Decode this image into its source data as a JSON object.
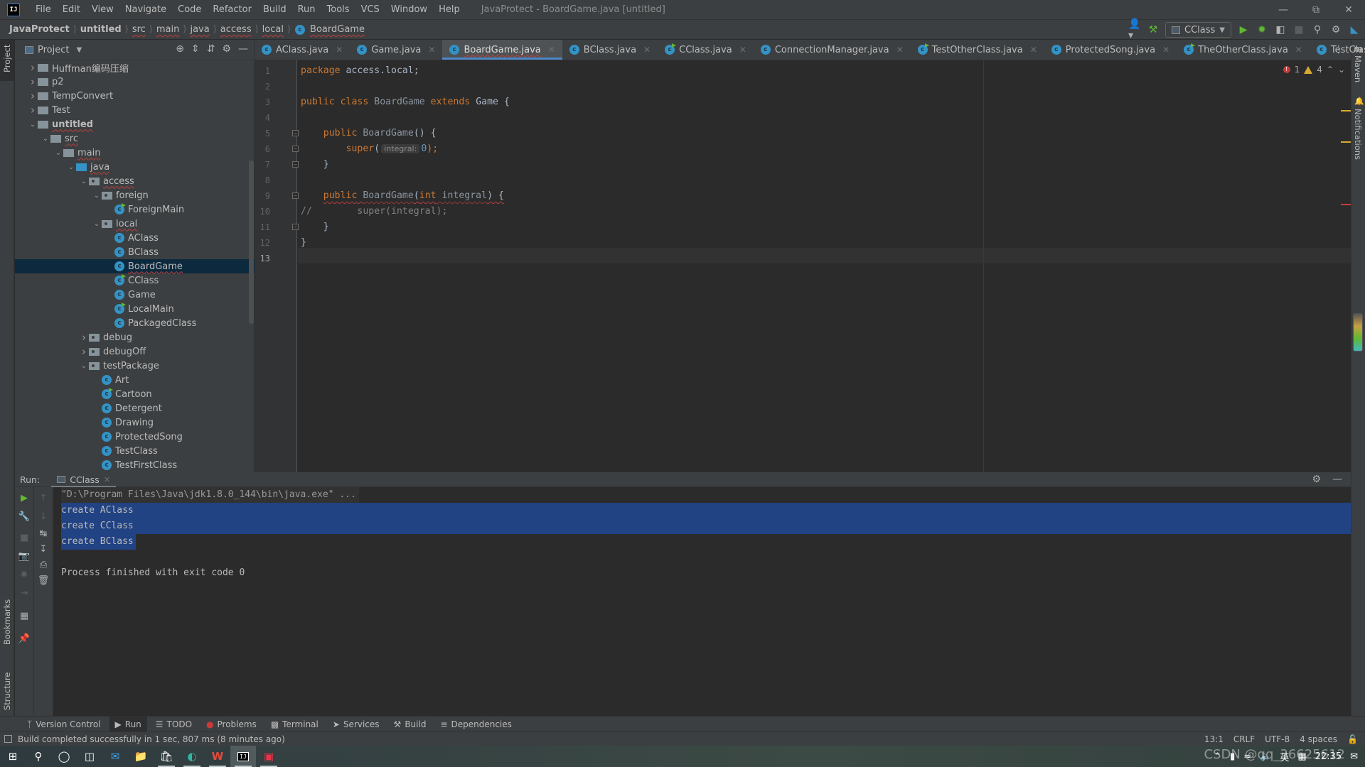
{
  "titlebar": {
    "logo": "IJ",
    "menu": [
      "File",
      "Edit",
      "View",
      "Navigate",
      "Code",
      "Refactor",
      "Build",
      "Run",
      "Tools",
      "VCS",
      "Window",
      "Help"
    ],
    "window_title": "JavaProtect - BoardGame.java [untitled]"
  },
  "breadcrumb": [
    "JavaProtect",
    "untitled",
    "src",
    "main",
    "java",
    "access",
    "local",
    "BoardGame"
  ],
  "toolbar": {
    "run_config": "CClass"
  },
  "left_stripe": {
    "project": "Project",
    "bookmarks": "Bookmarks",
    "structure": "Structure"
  },
  "right_stripe": {
    "maven": "Maven",
    "notifications": "Notifications"
  },
  "project_panel": {
    "title": "Project",
    "tree": [
      {
        "label": "Huffman编码压缩",
        "depth": 0,
        "type": "folder",
        "arrow": "right"
      },
      {
        "label": "p2",
        "depth": 0,
        "type": "folder",
        "arrow": "right"
      },
      {
        "label": "TempConvert",
        "depth": 0,
        "type": "folder",
        "arrow": "right"
      },
      {
        "label": "Test",
        "depth": 0,
        "type": "folder",
        "arrow": "right"
      },
      {
        "label": "untitled",
        "depth": 0,
        "type": "module",
        "arrow": "down"
      },
      {
        "label": "src",
        "depth": 1,
        "type": "folder",
        "arrow": "down"
      },
      {
        "label": "main",
        "depth": 2,
        "type": "folder",
        "arrow": "down"
      },
      {
        "label": "java",
        "depth": 3,
        "type": "src",
        "arrow": "down"
      },
      {
        "label": "access",
        "depth": 4,
        "type": "pkg",
        "arrow": "down"
      },
      {
        "label": "foreign",
        "depth": 5,
        "type": "pkg",
        "arrow": "down"
      },
      {
        "label": "ForeignMain",
        "depth": 6,
        "type": "class-run"
      },
      {
        "label": "local",
        "depth": 5,
        "type": "pkg",
        "arrow": "down"
      },
      {
        "label": "AClass",
        "depth": 6,
        "type": "class"
      },
      {
        "label": "BClass",
        "depth": 6,
        "type": "class"
      },
      {
        "label": "BoardGame",
        "depth": 6,
        "type": "class",
        "selected": true
      },
      {
        "label": "CClass",
        "depth": 6,
        "type": "class-run"
      },
      {
        "label": "Game",
        "depth": 6,
        "type": "class"
      },
      {
        "label": "LocalMain",
        "depth": 6,
        "type": "class-run"
      },
      {
        "label": "PackagedClass",
        "depth": 6,
        "type": "class"
      },
      {
        "label": "debug",
        "depth": 4,
        "type": "pkg",
        "arrow": "right"
      },
      {
        "label": "debugOff",
        "depth": 4,
        "type": "pkg",
        "arrow": "right"
      },
      {
        "label": "testPackage",
        "depth": 4,
        "type": "pkg",
        "arrow": "down"
      },
      {
        "label": "Art",
        "depth": 5,
        "type": "class"
      },
      {
        "label": "Cartoon",
        "depth": 5,
        "type": "class-run"
      },
      {
        "label": "Detergent",
        "depth": 5,
        "type": "class"
      },
      {
        "label": "Drawing",
        "depth": 5,
        "type": "class"
      },
      {
        "label": "ProtectedSong",
        "depth": 5,
        "type": "class"
      },
      {
        "label": "TestClass",
        "depth": 5,
        "type": "class"
      },
      {
        "label": "TestFirstClass",
        "depth": 5,
        "type": "class"
      }
    ]
  },
  "tabs": [
    {
      "label": "AClass.java",
      "run": false
    },
    {
      "label": "Game.java",
      "run": false
    },
    {
      "label": "BoardGame.java",
      "run": false,
      "active": true
    },
    {
      "label": "BClass.java",
      "run": false
    },
    {
      "label": "CClass.java",
      "run": true
    },
    {
      "label": "ConnectionManager.java",
      "run": false
    },
    {
      "label": "TestOtherClass.java",
      "run": true
    },
    {
      "label": "ProtectedSong.java",
      "run": false
    },
    {
      "label": "TheOtherClass.java",
      "run": true
    },
    {
      "label": "TestClass.java",
      "run": false
    }
  ],
  "editor": {
    "inspections": {
      "errors": "1",
      "warnings": "4"
    },
    "line_numbers": [
      "1",
      "2",
      "3",
      "4",
      "5",
      "6",
      "7",
      "8",
      "9",
      "10",
      "11",
      "12",
      "13"
    ],
    "code": {
      "l1_kw": "package",
      "l1_rest": " access.local;",
      "l3_kw1": "public",
      "l3_kw2": "class",
      "l3_name": "BoardGame",
      "l3_kw3": "extends",
      "l3_parent": "Game",
      "l3_brace": " {",
      "l5_kw": "public",
      "l5_name": "BoardGame",
      "l5_rest": "() {",
      "l6_kw": "super",
      "l6_open": "(",
      "l6_hint": "integral:",
      "l6_num": "0",
      "l6_close": ");",
      "l7": "}",
      "l9_kw": "public",
      "l9_name": "BoardGame",
      "l9_open": "(",
      "l9_type": "int",
      "l9_param": " integral",
      "l9_close": ") {",
      "l10_comment": "//        super(integral);",
      "l11": "}",
      "l12": "}"
    },
    "cursor_position": "13:1"
  },
  "run_panel": {
    "label": "Run:",
    "tab": "CClass",
    "console": [
      "\"D:\\Program Files\\Java\\jdk1.8.0_144\\bin\\java.exe\" ...",
      "create AClass",
      "create CClass",
      "create BClass",
      "",
      "Process finished with exit code 0"
    ]
  },
  "tool_windows": [
    "Version Control",
    "Run",
    "TODO",
    "Problems",
    "Terminal",
    "Services",
    "Build",
    "Dependencies"
  ],
  "status": {
    "message": "Build completed successfully in 1 sec, 807 ms (8 minutes ago)",
    "position": "13:1",
    "line_ending": "CRLF",
    "encoding": "UTF-8",
    "indent": "4 spaces"
  },
  "taskbar": {
    "tray_lang": "英",
    "tray_time": "22:35"
  },
  "watermark": "CSDN @qq_36625612",
  "colors": {
    "accent": "#4a88c7",
    "selection": "#214283",
    "keyword": "#cc7832",
    "error": "#c93b3b",
    "warning": "#d6a930"
  }
}
